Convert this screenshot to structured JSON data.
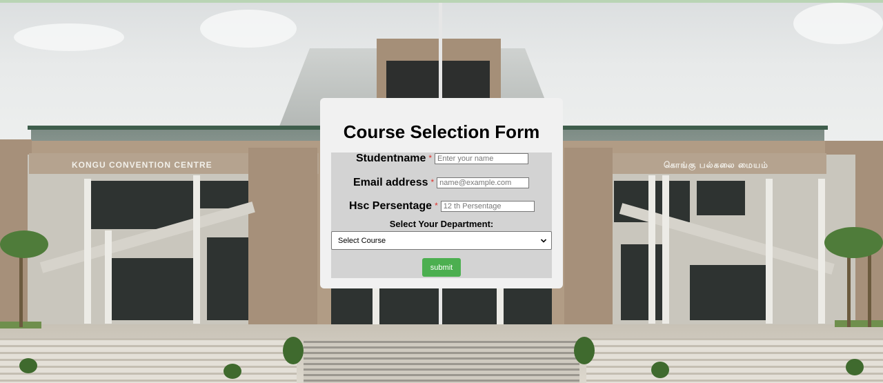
{
  "background": {
    "sign_left": "KONGU CONVENTION CENTRE",
    "sign_right": "கொங்கு பல்கலை மையம்"
  },
  "form": {
    "title": "Course Selection Form",
    "required_marker": "*",
    "fields": {
      "studentname": {
        "label": "Studentname",
        "placeholder": "Enter your name"
      },
      "email": {
        "label": "Email address",
        "placeholder": "name@example.com"
      },
      "hsc": {
        "label": "Hsc Persentage",
        "placeholder": "12 th Persentage"
      }
    },
    "department": {
      "label": "Select Your Department:",
      "selected": "Select Course"
    },
    "submit_label": "submit"
  },
  "colors": {
    "submit_bg": "#4caf50",
    "required": "#e0302a",
    "panel_bg": "#d3d3d3",
    "card_bg": "#f1f1f1"
  }
}
